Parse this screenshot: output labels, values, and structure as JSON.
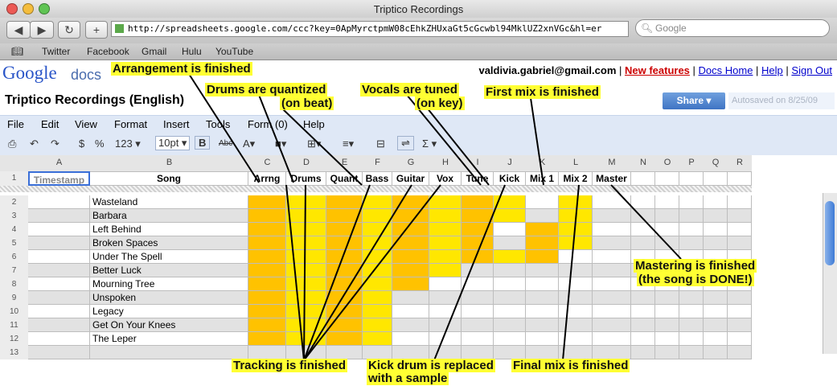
{
  "window": {
    "title": "Triptico Recordings"
  },
  "browser": {
    "url": "http://spreadsheets.google.com/ccc?key=0ApMyrctpmW08cEhkZHUxaGt5cGcwbl94MklUZ2xnVGc&hl=er",
    "search_placeholder": "Google",
    "bookmarks": [
      "Twitter",
      "Facebook",
      "Gmail",
      "Hulu",
      "YouTube"
    ]
  },
  "header": {
    "logo": "Google",
    "logo_docs": "docs",
    "user_email": "valdivia.gabriel@gmail.com",
    "links": [
      "New features",
      "Docs Home",
      "Help",
      "Sign Out"
    ],
    "doc_title": "Triptico Recordings (English)",
    "share_label": "Share ▾",
    "autosave": "Autosaved on 8/25/09"
  },
  "menu": [
    "File",
    "Edit",
    "View",
    "Format",
    "Insert",
    "Tools",
    "Form (0)",
    "Help"
  ],
  "toolbar": {
    "currency": "$",
    "percent": "%",
    "number_format": "123 ▾",
    "font_size": "10pt ▾",
    "bold": "B",
    "strike": "Abc",
    "sigma": "Σ ▾"
  },
  "sheet": {
    "column_letters": [
      "A",
      "B",
      "C",
      "D",
      "E",
      "F",
      "G",
      "H",
      "I",
      "J",
      "K",
      "L",
      "M",
      "N",
      "O",
      "P",
      "Q",
      "R"
    ],
    "header_row": [
      "Timestamp",
      "Song",
      "Arrng",
      "Drums",
      "Quant",
      "Bass",
      "Guitar",
      "Vox",
      "Tune",
      "Kick",
      "Mix 1",
      "Mix 2",
      "Master"
    ],
    "row_numbers": [
      "1",
      "2",
      "3",
      "4",
      "5",
      "6",
      "7",
      "8",
      "9",
      "10",
      "11",
      "12",
      "13"
    ],
    "songs": [
      "Wasteland",
      "Barbara",
      "Left Behind",
      "Broken Spaces",
      "Under The Spell",
      "Better Luck",
      "Mourning Tree",
      "Unspoken",
      "Legacy",
      "Get On Your Knees",
      "The Leper"
    ],
    "status": [
      "yyyyyyyywy",
      "yyyyyyyywy",
      "yyyyyyywyy",
      "yyyyyyywyy",
      "yyyyyyyyyw",
      "yyyyyywwww",
      "yyyyywwwww",
      "yyyywwwwww",
      "yyyywwwwww",
      "yyyywwwwww",
      "yyyywwwwww"
    ],
    "colors": {
      "done_even": "#ffe700",
      "done_odd": "#ffc200",
      "stripe": "#e2e2e2"
    }
  },
  "annotations": {
    "arrangement": "Arrangement is finished",
    "drums_quantized": "Drums are quantized",
    "on_beat": "(on beat)",
    "vocals_tuned": "Vocals are tuned",
    "on_key": "(on key)",
    "first_mix": "First mix is finished",
    "mastering_1": "Mastering is finished",
    "mastering_2": "(the song is DONE!)",
    "tracking": "Tracking is finished",
    "kick_1": "Kick drum is replaced",
    "kick_2": "with a sample",
    "final_mix": "Final mix is finished"
  }
}
